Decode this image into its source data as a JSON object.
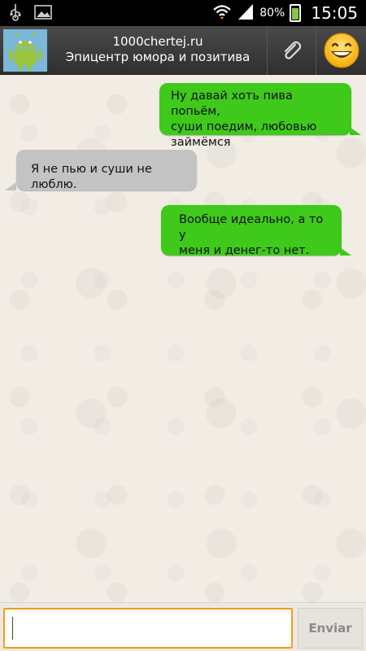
{
  "status_bar": {
    "battery_percent": "80%",
    "time": "15:05",
    "icons": [
      "usb-icon",
      "image-icon",
      "wifi-icon",
      "signal-icon",
      "battery-icon"
    ]
  },
  "header": {
    "title": "1000chertej.ru",
    "subtitle": "Эпицентр юмора и позитива",
    "avatar_icon": "android-icon",
    "attach_icon": "paperclip-icon",
    "emoji_icon": "smiley-icon"
  },
  "messages": [
    {
      "direction": "out",
      "text": "Ну давай хоть пива попьём,\nсуши поедим, любовью\nзаймёмся"
    },
    {
      "direction": "in",
      "text": "Я не пью и суши не люблю."
    },
    {
      "direction": "out",
      "text": "Вообще идеально, а то у\nменя и денег-то нет."
    }
  ],
  "composer": {
    "value": "",
    "send_label": "Enviar"
  },
  "colors": {
    "outgoing_bubble": "#3fc91b",
    "incoming_bubble": "#c3c3c3",
    "input_focus": "#f39c12",
    "header": "#3a3a3a"
  }
}
